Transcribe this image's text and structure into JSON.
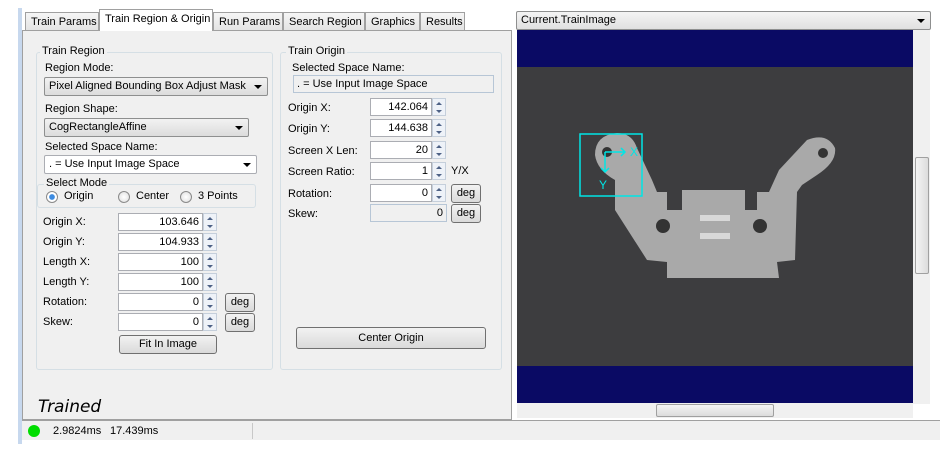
{
  "tabs": [
    {
      "label": "Train Params"
    },
    {
      "label": "Train Region & Origin"
    },
    {
      "label": "Run Params"
    },
    {
      "label": "Search Region"
    },
    {
      "label": "Graphics"
    },
    {
      "label": "Results"
    }
  ],
  "train_region": {
    "title": "Train Region",
    "region_mode_label": "Region Mode:",
    "region_mode": "Pixel Aligned Bounding Box Adjust Mask",
    "region_shape_label": "Region Shape:",
    "region_shape": "CogRectangleAffine",
    "space_label": "Selected Space Name:",
    "space": ". = Use Input Image Space",
    "select_mode": {
      "title": "Select Mode",
      "options": [
        "Origin",
        "Center",
        "3 Points"
      ],
      "selected": "Origin"
    },
    "fields": [
      {
        "label": "Origin X:",
        "value": "103.646"
      },
      {
        "label": "Origin Y:",
        "value": "104.933"
      },
      {
        "label": "Length X:",
        "value": "100"
      },
      {
        "label": "Length Y:",
        "value": "100"
      },
      {
        "label": "Rotation:",
        "value": "0",
        "unit": "deg"
      },
      {
        "label": "Skew:",
        "value": "0",
        "unit": "deg"
      }
    ],
    "fit_button": "Fit In Image"
  },
  "train_origin": {
    "title": "Train Origin",
    "space_label": "Selected Space Name:",
    "space": ". = Use Input Image Space",
    "fields": [
      {
        "label": "Origin X:",
        "value": "142.064"
      },
      {
        "label": "Origin Y:",
        "value": "144.638"
      },
      {
        "label": "Screen X Len:",
        "value": "20"
      },
      {
        "label": "Screen Ratio:",
        "value": "1",
        "suffix": "Y/X"
      },
      {
        "label": "Rotation:",
        "value": "0",
        "unit": "deg"
      },
      {
        "label": "Skew:",
        "value": "0",
        "unit": "deg"
      }
    ],
    "center_button": "Center Origin"
  },
  "trained_text": "Trained",
  "status": {
    "indicator_color": "#00dd00",
    "time1": "2.9824ms",
    "time2": "17.439ms"
  },
  "image_view": {
    "selector": "Current.TrainImage",
    "axis_x": "X",
    "axis_y": "Y",
    "overlay_color": "#00e5e5",
    "background_color": "#0a0a64"
  }
}
